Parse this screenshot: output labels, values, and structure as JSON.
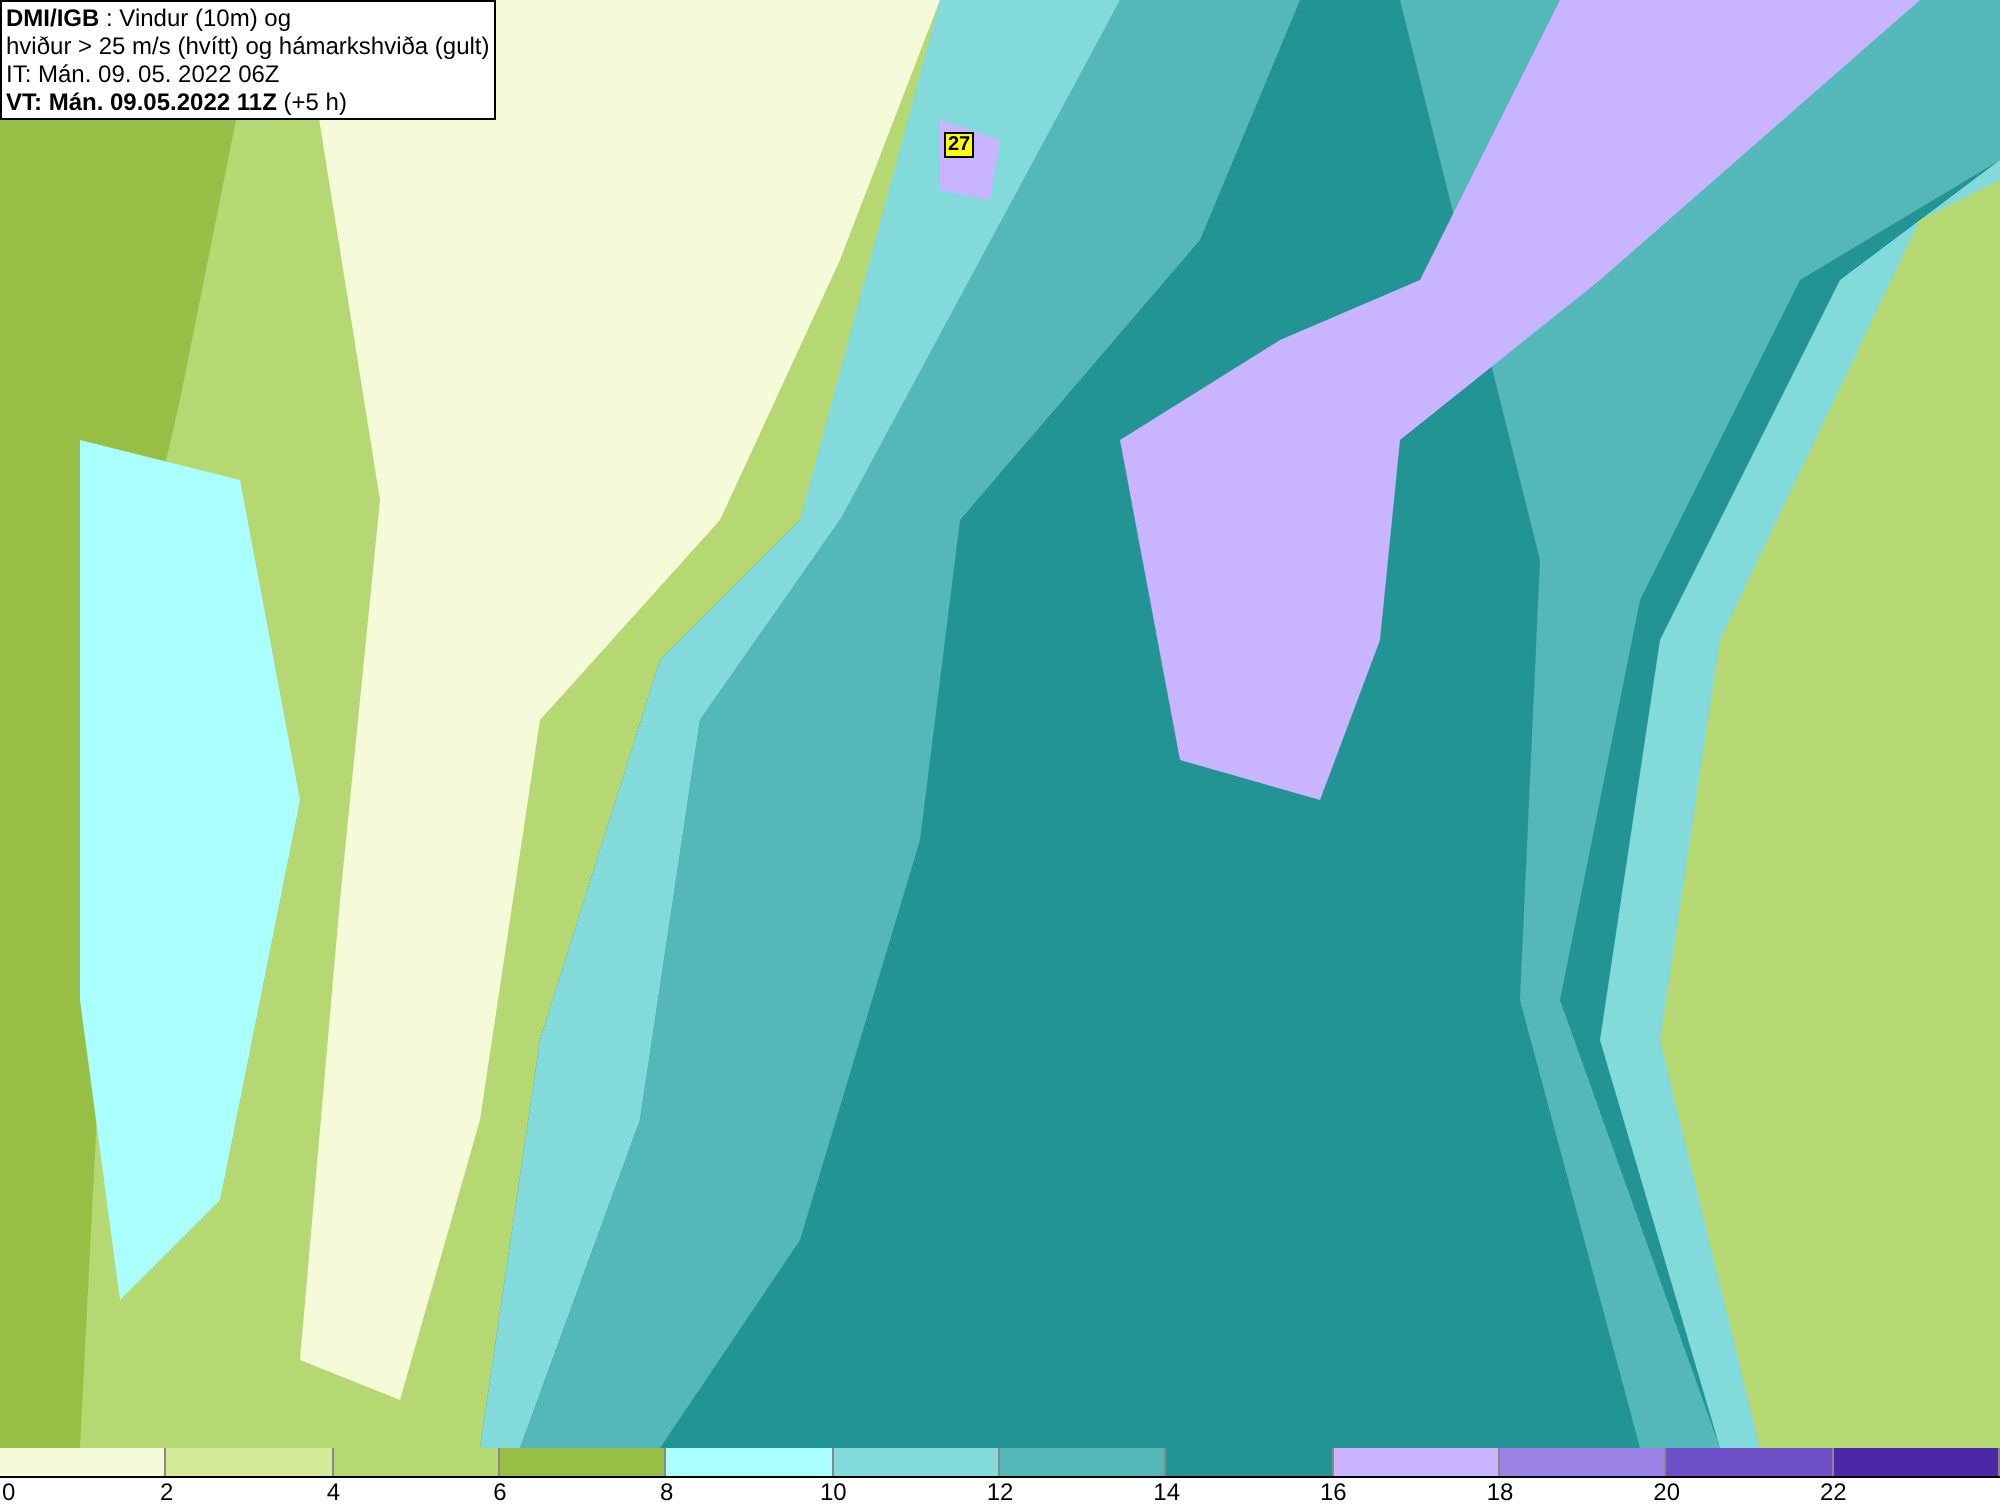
{
  "title_box": {
    "lines": [
      "**DMI/IGB** : Vindur (10m) og",
      "hviður > 25 m/s (hvítt) og hámarkshviða (gult)",
      "IT: Mán. 09. 05. 2022 06Z",
      "**VT: Mán. 09.05.2022 11Z** (+5 h)"
    ]
  },
  "map": {
    "gust_labels": [
      {
        "text": "27"
      }
    ]
  },
  "legend": [
    {
      "label": "0",
      "color": "#f5fbd9"
    },
    {
      "label": "2",
      "color": "#d4ec9a"
    },
    {
      "label": "4",
      "color": "#b5d873"
    },
    {
      "label": "6",
      "color": "#98bf45"
    },
    {
      "label": "8",
      "color": "#aaffff"
    },
    {
      "label": "10",
      "color": "#82dada"
    },
    {
      "label": "12",
      "color": "#55b8b8"
    },
    {
      "label": "14",
      "color": "#239494"
    },
    {
      "label": "16",
      "color": "#c8b4ff"
    },
    {
      "label": "18",
      "color": "#9b82e6"
    },
    {
      "label": "20",
      "color": "#7050c8"
    },
    {
      "label": "22",
      "color": "#4a28a8"
    }
  ]
}
